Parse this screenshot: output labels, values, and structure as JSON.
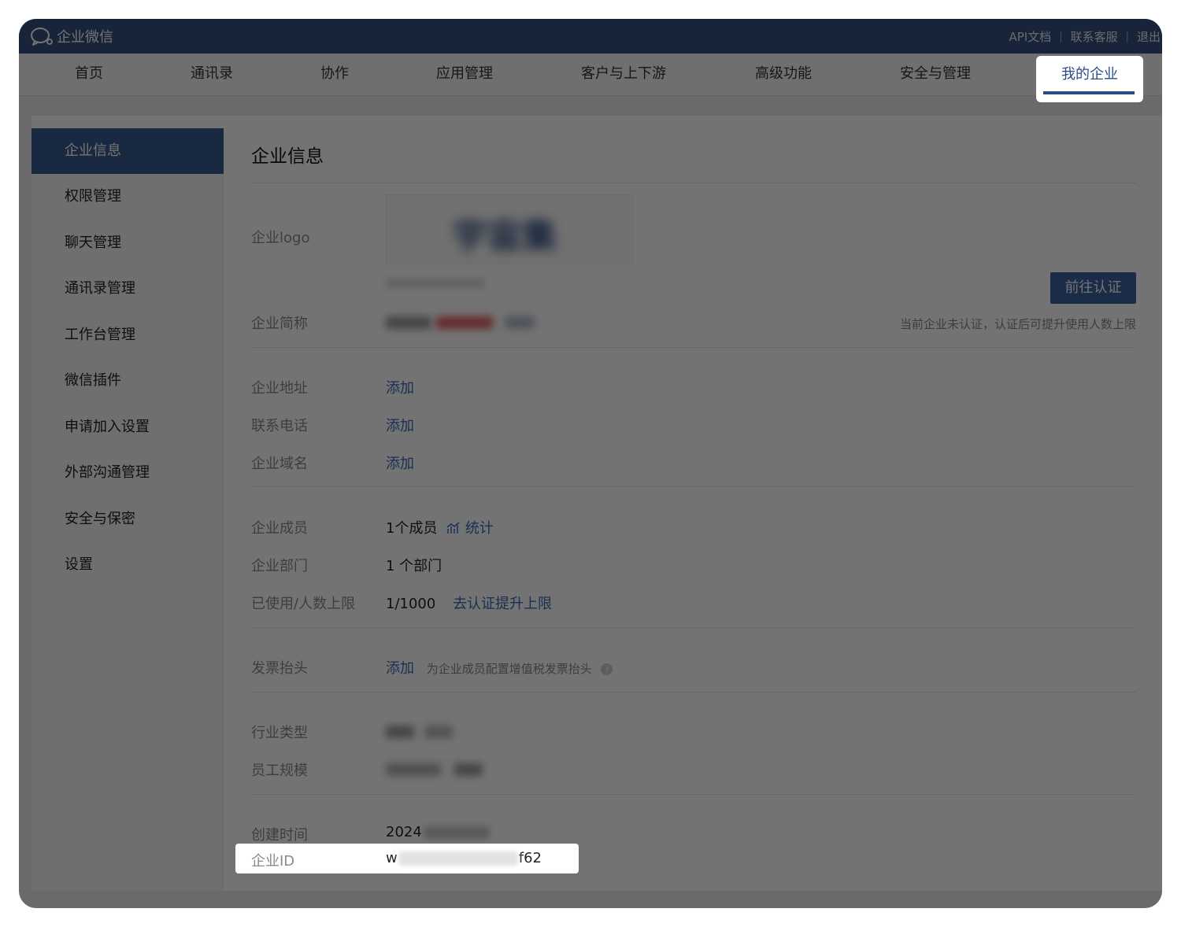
{
  "app": {
    "name": "企业微信",
    "links": [
      "API文档",
      "联系客服",
      "退出"
    ]
  },
  "nav": {
    "items": [
      "首页",
      "通讯录",
      "协作",
      "应用管理",
      "客户与上下游",
      "高级功能",
      "安全与管理",
      "我的企业"
    ],
    "active": "我的企业"
  },
  "sidebar": {
    "items": [
      "企业信息",
      "权限管理",
      "聊天管理",
      "通讯录管理",
      "工作台管理",
      "微信插件",
      "申请加入设置",
      "外部沟通管理",
      "安全与保密",
      "设置"
    ],
    "active": "企业信息"
  },
  "page": {
    "title": "企业信息",
    "logo_label": "企业logo",
    "short_name_label": "企业简称",
    "verify_button": "前往认证",
    "verify_hint": "当前企业未认证，认证后可提升使用人数上限",
    "address_label": "企业地址",
    "address_action": "添加",
    "phone_label": "联系电话",
    "phone_action": "添加",
    "domain_label": "企业域名",
    "domain_action": "添加",
    "members_label": "企业成员",
    "members_value": "1个成员",
    "members_stats": "统计",
    "departments_label": "企业部门",
    "departments_value": "1 个部门",
    "usage_label": "已使用/人数上限",
    "usage_value": "1/1000",
    "usage_action": "去认证提升上限",
    "invoice_label": "发票抬头",
    "invoice_action": "添加",
    "invoice_hint": "为企业成员配置增值税发票抬头",
    "industry_label": "行业类型",
    "size_label": "员工规模",
    "created_label": "创建时间",
    "created_value": "2024",
    "corp_id_label": "企业ID",
    "corp_id_prefix": "w",
    "corp_id_suffix": "f62"
  },
  "colors": {
    "topbar": "#33507e",
    "accent": "#3b6cb8",
    "sidebar_active": "#3b5b92",
    "button": "#3d63a3"
  }
}
